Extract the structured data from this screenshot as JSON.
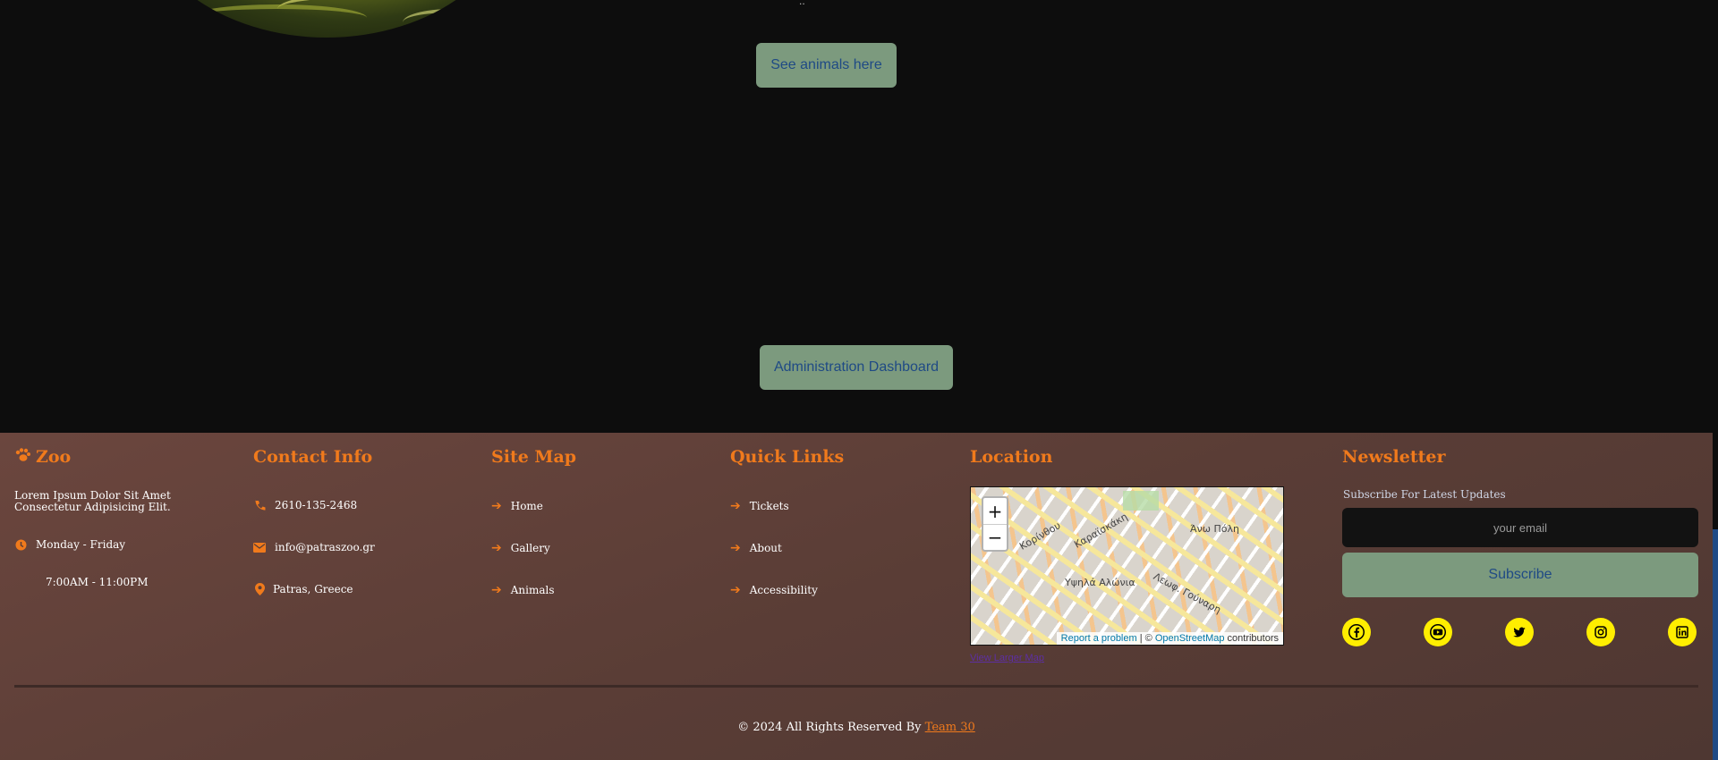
{
  "hero": {
    "tiny_text": "..",
    "see_animals_label": "See animals here",
    "admin_label": "Administration Dashboard"
  },
  "footer": {
    "brand": {
      "title": "Zoo",
      "description": "Lorem Ipsum Dolor Sit Amet Consectetur Adipisicing Elit.",
      "days": "Monday - Friday",
      "hours": "7:00AM - 11:00PM"
    },
    "contact": {
      "title": "Contact Info",
      "phone": "2610-135-2468",
      "email": "info@patraszoo.gr",
      "address": "Patras, Greece"
    },
    "sitemap": {
      "title": "Site Map",
      "items": [
        "Home",
        "Gallery",
        "Animals"
      ]
    },
    "quicklinks": {
      "title": "Quick Links",
      "items": [
        "Tickets",
        "About",
        "Accessibility"
      ]
    },
    "location": {
      "title": "Location",
      "zoom_in": "+",
      "zoom_out": "−",
      "report": "Report a problem",
      "osm_prefix": " | © ",
      "osm": "OpenStreetMap",
      "contributors": " contributors",
      "larger_map": "View Larger Map",
      "map_labels": [
        "Άνω Πόλη",
        "Υψηλά Αλώνια",
        "Κορίνθου",
        "Λεωφ. Γούναρη",
        "Καραϊσκάκη"
      ]
    },
    "newsletter": {
      "title": "Newsletter",
      "subtitle": "Subscribe For Latest Updates",
      "placeholder": "your email",
      "button": "Subscribe"
    },
    "social": [
      "facebook-icon",
      "youtube-icon",
      "twitter-icon",
      "instagram-icon",
      "linkedin-icon"
    ],
    "copyright_text": "© 2024 All Rights Reserved By ",
    "team": "Team 30"
  },
  "colors": {
    "accent": "#f07a1c",
    "button_bg": "#7c9a7e",
    "button_text": "#1f4a85",
    "social_bg": "#ffee00"
  }
}
